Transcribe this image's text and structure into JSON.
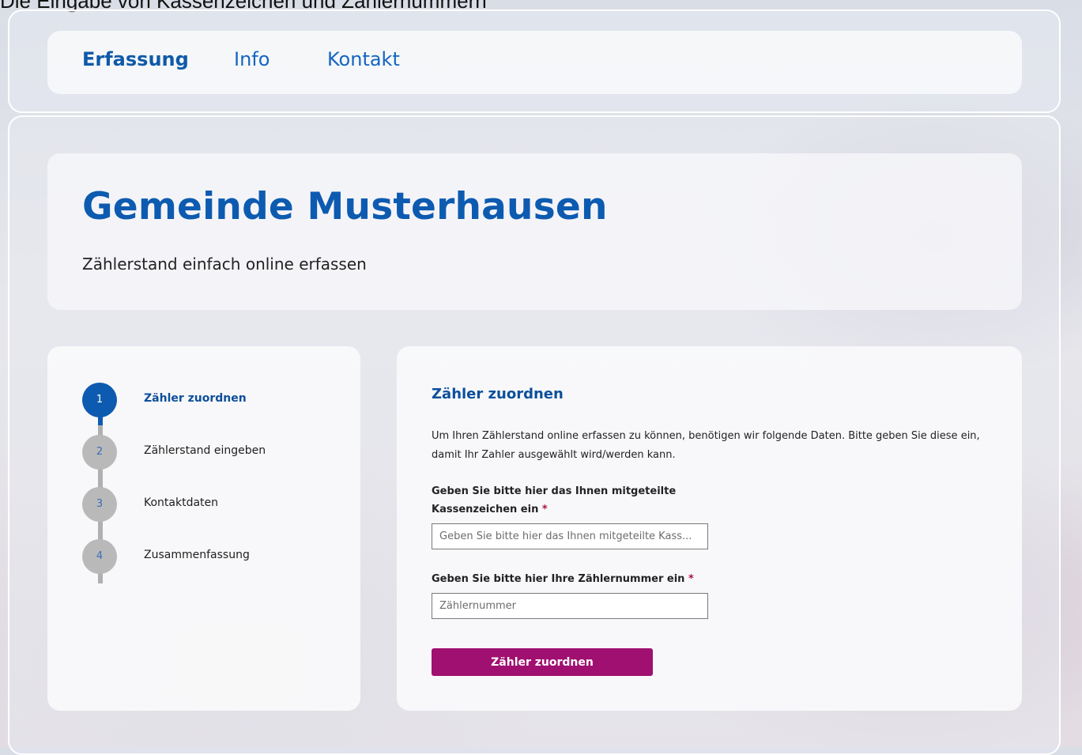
{
  "caption": "Die Eingabe von Kassenzeichen und Zählernummern",
  "nav": {
    "items": [
      "Erfassung",
      "Info",
      "Kontakt"
    ],
    "active": "Erfassung"
  },
  "hero": {
    "title": "Gemeinde Musterhausen",
    "subtitle": "Zählerstand einfach online erfassen"
  },
  "steps": [
    {
      "number": "1",
      "label": "Zähler zuordnen",
      "active": true
    },
    {
      "number": "2",
      "label": "Zählerstand eingeben",
      "active": false
    },
    {
      "number": "3",
      "label": "Kontaktdaten",
      "active": false
    },
    {
      "number": "4",
      "label": "Zusammenfassung",
      "active": false
    }
  ],
  "form": {
    "heading": "Zähler zuordnen",
    "intro": "Um Ihren Zählerstand online erfassen zu können, benötigen wir folgende Daten. Bitte geben Sie diese ein, damit Ihr Zahler ausgewählt wird/werden kann.",
    "kassenzeichen": {
      "label_line1": "Geben Sie bitte hier das Ihnen mitgeteilte",
      "label_line2": "Kassenzeichen ein",
      "required_marker": "*",
      "placeholder": "Geben Sie bitte hier das Ihnen mitgeteilte Kass..."
    },
    "zaehlernummer": {
      "label": "Geben Sie bitte hier Ihre Zählernummer ein",
      "required_marker": "*",
      "placeholder": "Zählernummer"
    },
    "submit_label": "Zähler zuordnen"
  },
  "colors": {
    "primary": "#0d5bb0",
    "button": "#a01070",
    "required": "#b0103a",
    "inactive_step": "#b9b9b9"
  }
}
